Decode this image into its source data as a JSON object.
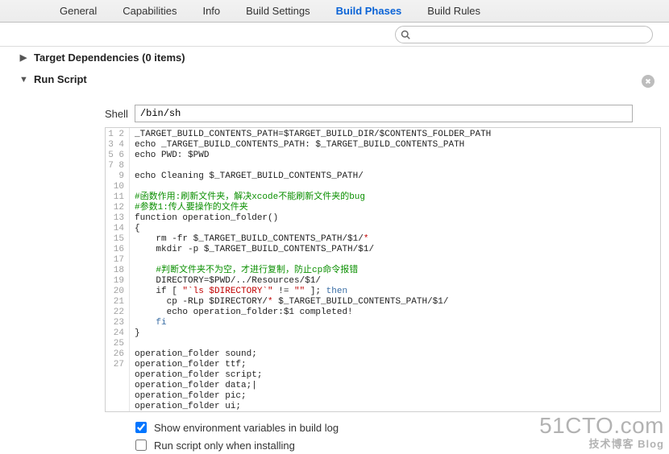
{
  "tabs": {
    "general": "General",
    "capabilities": "Capabilities",
    "info": "Info",
    "build_settings": "Build Settings",
    "build_phases": "Build Phases",
    "build_rules": "Build Rules",
    "selected": "build_phases"
  },
  "search": {
    "placeholder": ""
  },
  "phases": {
    "target_deps": {
      "title": "Target Dependencies (0 items)",
      "expanded": false
    },
    "run_script": {
      "title": "Run Script",
      "expanded": true
    }
  },
  "shell": {
    "label": "Shell",
    "value": "/bin/sh"
  },
  "script_lines": [
    {
      "n": 1,
      "segs": [
        {
          "t": "_TARGET_BUILD_CONTENTS_PATH=$TARGET_BUILD_DIR/$CONTENTS_FOLDER_PATH",
          "c": ""
        }
      ]
    },
    {
      "n": 2,
      "segs": [
        {
          "t": "echo _TARGET_BUILD_CONTENTS_PATH: $_TARGET_BUILD_CONTENTS_PATH",
          "c": ""
        }
      ]
    },
    {
      "n": 3,
      "segs": [
        {
          "t": "echo PWD: $PWD",
          "c": ""
        }
      ]
    },
    {
      "n": 4,
      "segs": [
        {
          "t": "",
          "c": ""
        }
      ]
    },
    {
      "n": 5,
      "segs": [
        {
          "t": "echo Cleaning $_TARGET_BUILD_CONTENTS_PATH/",
          "c": ""
        }
      ]
    },
    {
      "n": 6,
      "segs": [
        {
          "t": "",
          "c": ""
        }
      ]
    },
    {
      "n": 7,
      "segs": [
        {
          "t": "#函数作用:刷新文件夹，解决xcode不能刷新文件夹的bug",
          "c": "cmt"
        }
      ]
    },
    {
      "n": 8,
      "segs": [
        {
          "t": "#参数1:传人要操作的文件夹",
          "c": "cmt"
        }
      ]
    },
    {
      "n": 9,
      "segs": [
        {
          "t": "function operation_folder()",
          "c": ""
        }
      ]
    },
    {
      "n": 10,
      "segs": [
        {
          "t": "{",
          "c": ""
        }
      ]
    },
    {
      "n": 11,
      "segs": [
        {
          "t": "    rm -fr $_TARGET_BUILD_CONTENTS_PATH/$1/",
          "c": ""
        },
        {
          "t": "*",
          "c": "str"
        }
      ]
    },
    {
      "n": 12,
      "segs": [
        {
          "t": "    mkdir -p $_TARGET_BUILD_CONTENTS_PATH/$1/",
          "c": ""
        }
      ]
    },
    {
      "n": 13,
      "segs": [
        {
          "t": "",
          "c": ""
        }
      ]
    },
    {
      "n": 14,
      "segs": [
        {
          "t": "    #判断文件夹不为空，才进行复制，防止cp命令报错",
          "c": "cmt"
        }
      ]
    },
    {
      "n": 15,
      "segs": [
        {
          "t": "    DIRECTORY=$PWD/../Resources/$1/",
          "c": ""
        }
      ]
    },
    {
      "n": 16,
      "segs": [
        {
          "t": "    if [ ",
          "c": ""
        },
        {
          "t": "\"`ls $DIRECTORY`\"",
          "c": "str"
        },
        {
          "t": " != ",
          "c": ""
        },
        {
          "t": "\"\"",
          "c": "str"
        },
        {
          "t": " ]; ",
          "c": ""
        },
        {
          "t": "then",
          "c": "kw"
        }
      ]
    },
    {
      "n": 17,
      "segs": [
        {
          "t": "      cp -RLp $DIRECTORY/",
          "c": ""
        },
        {
          "t": "*",
          "c": "str"
        },
        {
          "t": " $_TARGET_BUILD_CONTENTS_PATH/$1/",
          "c": ""
        }
      ]
    },
    {
      "n": 18,
      "segs": [
        {
          "t": "      echo operation_folder:$1 completed!",
          "c": ""
        }
      ]
    },
    {
      "n": 19,
      "segs": [
        {
          "t": "    fi",
          "c": "kw"
        }
      ]
    },
    {
      "n": 20,
      "segs": [
        {
          "t": "}",
          "c": ""
        }
      ]
    },
    {
      "n": 21,
      "segs": [
        {
          "t": "",
          "c": ""
        }
      ]
    },
    {
      "n": 22,
      "segs": [
        {
          "t": "operation_folder sound;",
          "c": ""
        }
      ]
    },
    {
      "n": 23,
      "segs": [
        {
          "t": "operation_folder ttf;",
          "c": ""
        }
      ]
    },
    {
      "n": 24,
      "segs": [
        {
          "t": "operation_folder script;",
          "c": ""
        }
      ]
    },
    {
      "n": 25,
      "segs": [
        {
          "t": "operation_folder data;|",
          "c": ""
        }
      ]
    },
    {
      "n": 26,
      "segs": [
        {
          "t": "operation_folder pic;",
          "c": ""
        }
      ]
    },
    {
      "n": 27,
      "segs": [
        {
          "t": "operation_folder ui;",
          "c": ""
        }
      ]
    }
  ],
  "checks": {
    "show_env": {
      "label": "Show environment variables in build log",
      "checked": true
    },
    "only_install": {
      "label": "Run script only when installing",
      "checked": false
    }
  },
  "watermark": {
    "big": "51CTO.com",
    "small": "技术博客  Blog"
  }
}
